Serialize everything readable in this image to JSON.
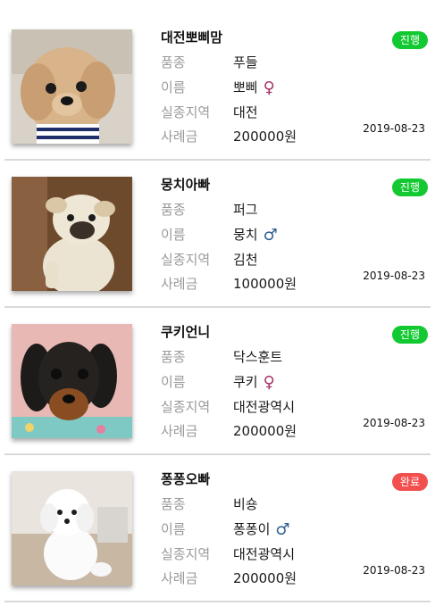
{
  "labels": {
    "breed": "품종",
    "name": "이름",
    "region": "실종지역",
    "reward": "사례금"
  },
  "colors": {
    "ongoing": "#13c931",
    "done": "#f24f4f",
    "female": "#a8326a",
    "male": "#2e5f8f"
  },
  "posts": [
    {
      "author": "대전뽀삐맘",
      "status": "진행",
      "breed": "푸들",
      "name": "뽀삐",
      "gender_icon": "female-icon",
      "gender_symbol": "♀",
      "region": "대전",
      "reward": "200000원",
      "date": "2019-08-23"
    },
    {
      "author": "뭉치아빠",
      "status": "진행",
      "breed": "퍼그",
      "name": "뭉치",
      "gender_icon": "male-icon",
      "gender_symbol": "♂",
      "region": "김천",
      "reward": "100000원",
      "date": "2019-08-23"
    },
    {
      "author": "쿠키언니",
      "status": "진행",
      "breed": "닥스훈트",
      "name": "쿠키",
      "gender_icon": "female-icon",
      "gender_symbol": "♀",
      "region": "대전광역시",
      "reward": "200000원",
      "date": "2019-08-23"
    },
    {
      "author": "퐁퐁오빠",
      "status": "완료",
      "breed": "비숑",
      "name": "퐁퐁이",
      "gender_icon": "male-icon",
      "gender_symbol": "♂",
      "region": "대전광역시",
      "reward": "200000원",
      "date": "2019-08-23"
    }
  ]
}
